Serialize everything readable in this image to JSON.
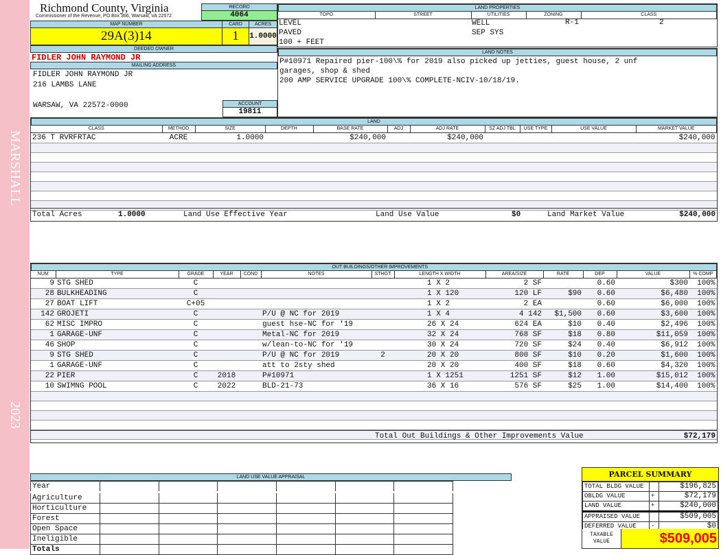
{
  "side": {
    "name": "MARSHALL",
    "year": "2023"
  },
  "header": {
    "county": "Richmond County, Virginia",
    "subtitle": "Commissioner of the Revenue, PO Box 366, Warsaw, VA 22572",
    "record_label": "RECORD",
    "record": "4064",
    "map_label": "MAP NUMBER",
    "map": "29A(3)14",
    "card_label": "CARD",
    "card": "1",
    "acres_label": "ACRES",
    "acres": "1.0000"
  },
  "owner": {
    "label": "DEEDED OWNER",
    "name": "FIDLER JOHN RAYMOND JR",
    "mail_label": "MAILING ADDRESS",
    "lines": [
      "FIDLER JOHN RAYMOND JR",
      "216 LAMBS LANE",
      "",
      "WARSAW, VA 22572-0000"
    ],
    "account_label": "ACCOUNT",
    "account": "19811"
  },
  "land_props": {
    "label": "LAND PROPERTIES",
    "headers": [
      "TOPO",
      "STREET",
      "UTILITIES",
      "ZONING",
      "CLASS"
    ],
    "topo": [
      "LEVEL",
      "PAVED",
      "100 + FEET"
    ],
    "utilities": [
      "WELL",
      "SEP SYS"
    ],
    "zoning": "R-1",
    "class": "2"
  },
  "land_notes": {
    "label": "LAND NOTES",
    "lines": [
      "P#10971 Repaired pier-100\\% for 2019 also picked up jetties, guest house, 2 unf",
      "garages, shop & shed",
      "200 AMP SERVICE UPGRADE 100\\% COMPLETE-NCIV-10/18/19."
    ]
  },
  "land": {
    "label": "LAND",
    "headers": [
      "CLASS",
      "METHOD",
      "SIZE",
      "DEPTH",
      "BASE RATE",
      "ADJ",
      "ADJ RATE",
      "SZ ADJ TBL",
      "USE TYPE",
      "USE VALUE",
      "MARKET VALUE"
    ],
    "rows": [
      [
        "236 T RVRFRTAC",
        "ACRE",
        "1.0000",
        "",
        "$240,000",
        "",
        "$240,000",
        "",
        "",
        "",
        "$240,000"
      ]
    ],
    "total_acres_label": "Total Acres",
    "total_acres": "1.0000",
    "effective_year_label": "Land Use Effective Year",
    "use_value_label": "Land Use Value",
    "use_value": "$0",
    "market_label": "Land Market Value",
    "market": "$240,000"
  },
  "outbuildings": {
    "label": "OUT BUILDINGS/OTHER IMPROVEMENTS",
    "headers": [
      "NUM",
      "TYPE",
      "GRADE",
      "YEAR",
      "COND",
      "NOTES",
      "STHGT",
      "LENGTH X WIDTH",
      "AREA/SIZE",
      "RATE",
      "DEP",
      "VALUE",
      "% COMP"
    ],
    "rows": [
      [
        "9",
        "STG SHED",
        "C",
        "",
        "",
        "",
        "",
        "1 X 2",
        "2 SF",
        "",
        "0.60",
        "$300",
        "100%"
      ],
      [
        "28",
        "BULKHEADING",
        "C",
        "",
        "",
        "",
        "",
        "1 X 120",
        "120 LF",
        "$90",
        "0.60",
        "$6,480",
        "100%"
      ],
      [
        "27",
        "BOAT LIFT",
        "C+05",
        "",
        "",
        "",
        "",
        "1 X 2",
        "2 EA",
        "",
        "0.60",
        "$6,000",
        "100%"
      ],
      [
        "142",
        "GROJETI",
        "C",
        "",
        "",
        "P/U @ NC for 2019",
        "",
        "1 X 4",
        "4 142",
        "$1,500",
        "0.60",
        "$3,600",
        "100%"
      ],
      [
        "62",
        "MISC IMPRO",
        "C",
        "",
        "",
        "guest hse-NC for '19",
        "",
        "26 X 24",
        "624 EA",
        "$10",
        "0.40",
        "$2,496",
        "100%"
      ],
      [
        "1",
        "GARAGE-UNF",
        "C",
        "",
        "",
        "Metal-NC for 2019",
        "",
        "32 X 24",
        "768 SF",
        "$18",
        "0.80",
        "$11,059",
        "100%"
      ],
      [
        "46",
        "SHOP",
        "C",
        "",
        "",
        "w/lean-to-NC for '19",
        "",
        "30 X 24",
        "720 SF",
        "$24",
        "0.40",
        "$6,912",
        "100%"
      ],
      [
        "9",
        "STG SHED",
        "C",
        "",
        "",
        "P/U @ NC for 2019",
        "2",
        "20 X 20",
        "800 SF",
        "$10",
        "0.20",
        "$1,600",
        "100%"
      ],
      [
        "1",
        "GARAGE-UNF",
        "C",
        "",
        "",
        "att to 2sty shed",
        "",
        "20 X 20",
        "400 SF",
        "$18",
        "0.60",
        "$4,320",
        "100%"
      ],
      [
        "22",
        "PIER",
        "C",
        "2018",
        "",
        "P#10971",
        "",
        "1 X 1251",
        "1251 SF",
        "$12",
        "1.00",
        "$15,012",
        "100%"
      ],
      [
        "10",
        "SWIMNG POOL",
        "C",
        "2022",
        "",
        "BLD-21-73",
        "",
        "36 X 16",
        "576 SF",
        "$25",
        "1.00",
        "$14,400",
        "100%"
      ]
    ],
    "total_label": "Total Out Buildings & Other Improvements Value",
    "total": "$72,179"
  },
  "land_use": {
    "label": "LAND USE VALUE APPRAISAL",
    "year_label": "Year",
    "rows": [
      "Agriculture",
      "Horticulture",
      "Forest",
      "Open Space",
      "Ineligible"
    ],
    "totals_label": "Totals"
  },
  "summary": {
    "title": "PARCEL SUMMARY",
    "rows": [
      [
        "TOTAL BLDG VALUE",
        "",
        "$196,825"
      ],
      [
        "OBLDG VALUE",
        "+",
        "$72,179"
      ],
      [
        "LAND VALUE",
        "+",
        "$240,000"
      ],
      [
        "APPRAISED VALUE",
        "",
        "$509,005"
      ],
      [
        "DEFERRED VALUE",
        "-",
        "$0"
      ]
    ],
    "taxable_label": "TAXABLE VALUE",
    "taxable": "$509,005"
  },
  "colors": {
    "label_bg": "#add8e6",
    "highlight": "#ffff00",
    "record_bg": "#90ee90",
    "owner_red": "#cc0000",
    "strip": "#f6c0c8"
  }
}
